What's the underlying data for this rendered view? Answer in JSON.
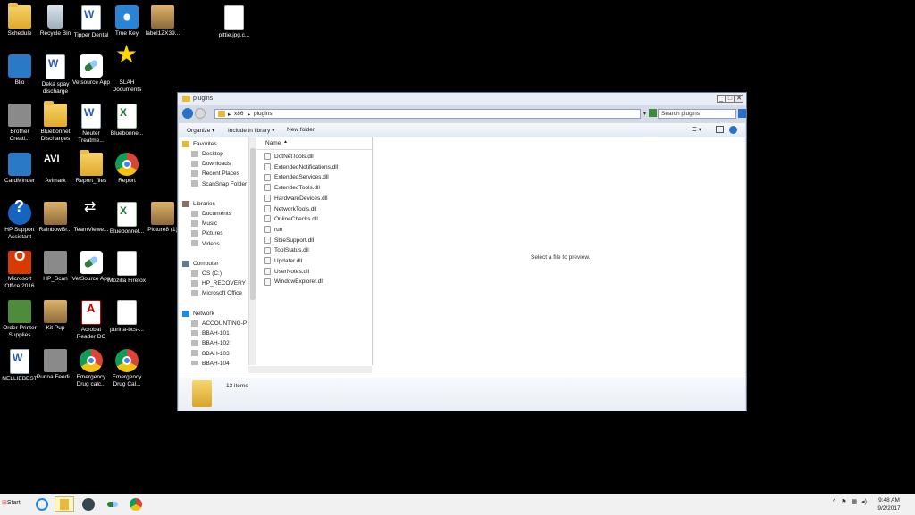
{
  "desktop": {
    "icons": [
      {
        "label": "Schedule",
        "kind": "folder"
      },
      {
        "label": "Recycle Bin",
        "kind": "recycle"
      },
      {
        "label": "Tipper Dental",
        "kind": "word"
      },
      {
        "label": "True Key",
        "kind": "truekey"
      },
      {
        "label": "label1ZX39...",
        "kind": "photo"
      },
      {
        "label": "pittie.jpg.c...",
        "kind": "doc"
      },
      {
        "label": "Blio",
        "kind": "blue"
      },
      {
        "label": "Deka spay discharge",
        "kind": "word"
      },
      {
        "label": "Vetsource App",
        "kind": "pill"
      },
      {
        "label": "SLAH Documents",
        "kind": "star"
      },
      {
        "label": "Brother Creati...",
        "kind": "gray"
      },
      {
        "label": "Bluebonnet Discharges",
        "kind": "folder"
      },
      {
        "label": "Neuter Treatme...",
        "kind": "word"
      },
      {
        "label": "Bluebonne...",
        "kind": "excel"
      },
      {
        "label": "CardMinder",
        "kind": "blue"
      },
      {
        "label": "Avimark",
        "kind": "avi"
      },
      {
        "label": "Report_files",
        "kind": "folder"
      },
      {
        "label": "Report",
        "kind": "chrome"
      },
      {
        "label": "HP Support Assistant",
        "kind": "help"
      },
      {
        "label": "RainbowBr...",
        "kind": "photo"
      },
      {
        "label": "TeamViewe...",
        "kind": "teamv"
      },
      {
        "label": "Bluebonnet...",
        "kind": "excel"
      },
      {
        "label": "Picture8 (1)",
        "kind": "photo"
      },
      {
        "label": "Microsoft Office 2016",
        "kind": "office"
      },
      {
        "label": "HP_Scan",
        "kind": "gray"
      },
      {
        "label": "VetSource App",
        "kind": "pill"
      },
      {
        "label": "Mozilla Firefox",
        "kind": "doc"
      },
      {
        "label": "Order Printer Supplies",
        "kind": "green"
      },
      {
        "label": "Kit Pup",
        "kind": "photo"
      },
      {
        "label": "Acrobat Reader DC",
        "kind": "pdf"
      },
      {
        "label": "purina-bcs-...",
        "kind": "doc"
      },
      {
        "label": "NELLIEBEST",
        "kind": "word"
      },
      {
        "label": "Purina Feedi...",
        "kind": "gray"
      },
      {
        "label": "Emergency Drug calc...",
        "kind": "chrome"
      },
      {
        "label": "Emergency Drug Cal...",
        "kind": "chrome"
      }
    ]
  },
  "window": {
    "title": "plugins",
    "address": {
      "segments": [
        "x86",
        "plugins"
      ],
      "separator": "▸"
    },
    "search_placeholder": "Search plugins",
    "toolbar": {
      "organize": "Organize ▾",
      "include": "Include in library ▾",
      "newfolder": "New folder"
    },
    "nav": {
      "favorites": {
        "header": "Favorites",
        "items": [
          "Desktop",
          "Downloads",
          "Recent Places",
          "ScanSnap Folder"
        ]
      },
      "libraries": {
        "header": "Libraries",
        "items": [
          "Documents",
          "Music",
          "Pictures",
          "Videos"
        ]
      },
      "computer": {
        "header": "Computer",
        "items": [
          "OS (C:)",
          "HP_RECOVERY (D",
          "Microsoft Office"
        ]
      },
      "network": {
        "header": "Network",
        "items": [
          "ACCOUNTING-P",
          "BBAH-101",
          "BBAH-102",
          "BBAH-103",
          "BBAH-104"
        ]
      }
    },
    "column_name": "Name",
    "files": [
      "DotNetTools.dll",
      "ExtendedNotifications.dll",
      "ExtendedServices.dll",
      "ExtendedTools.dll",
      "HardwareDevices.dll",
      "NetworkTools.dll",
      "OnlineChecks.dll",
      "run",
      "SbieSupport.dll",
      "ToolStatus.dll",
      "Updater.dll",
      "UserNotes.dll",
      "WindowExplorer.dll"
    ],
    "preview_text": "Select a file to preview.",
    "status": "13 items"
  },
  "taskbar": {
    "start": "Start",
    "clock_time": "9:48 AM",
    "clock_date": "9/2/2017"
  },
  "colors": {
    "desktop": "#000000",
    "window_frame": "#d4dbe6",
    "accent": "#2a6fc9"
  }
}
